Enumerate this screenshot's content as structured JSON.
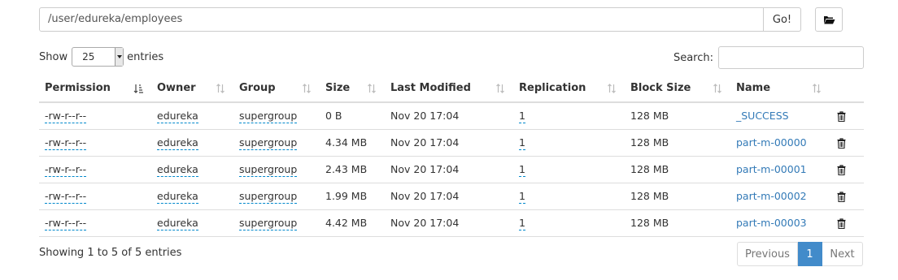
{
  "toolbar": {
    "path_value": "/user/edureka/employees",
    "go_label": "Go!",
    "folder_icon": "folder-open-icon"
  },
  "length": {
    "show_label": "Show",
    "selected": "25",
    "entries_label": "entries"
  },
  "search": {
    "label": "Search:",
    "value": ""
  },
  "table": {
    "columns": [
      "Permission",
      "Owner",
      "Group",
      "Size",
      "Last Modified",
      "Replication",
      "Block Size",
      "Name"
    ],
    "sorted_column": "Permission",
    "rows": [
      {
        "permission": "-rw-r--r--",
        "owner": "edureka",
        "group": "supergroup",
        "size": "0 B",
        "modified": "Nov 20 17:04",
        "replication": "1",
        "block_size": "128 MB",
        "name": "_SUCCESS"
      },
      {
        "permission": "-rw-r--r--",
        "owner": "edureka",
        "group": "supergroup",
        "size": "4.34 MB",
        "modified": "Nov 20 17:04",
        "replication": "1",
        "block_size": "128 MB",
        "name": "part-m-00000"
      },
      {
        "permission": "-rw-r--r--",
        "owner": "edureka",
        "group": "supergroup",
        "size": "2.43 MB",
        "modified": "Nov 20 17:04",
        "replication": "1",
        "block_size": "128 MB",
        "name": "part-m-00001"
      },
      {
        "permission": "-rw-r--r--",
        "owner": "edureka",
        "group": "supergroup",
        "size": "1.99 MB",
        "modified": "Nov 20 17:04",
        "replication": "1",
        "block_size": "128 MB",
        "name": "part-m-00002"
      },
      {
        "permission": "-rw-r--r--",
        "owner": "edureka",
        "group": "supergroup",
        "size": "4.42 MB",
        "modified": "Nov 20 17:04",
        "replication": "1",
        "block_size": "128 MB",
        "name": "part-m-00003"
      }
    ]
  },
  "footer": {
    "info": "Showing 1 to 5 of 5 entries",
    "previous_label": "Previous",
    "current_page": "1",
    "next_label": "Next"
  },
  "colors": {
    "link": "#337ab7",
    "active_page": "#428bca",
    "dashed_underline": "#0088cc",
    "border": "#dddddd"
  }
}
